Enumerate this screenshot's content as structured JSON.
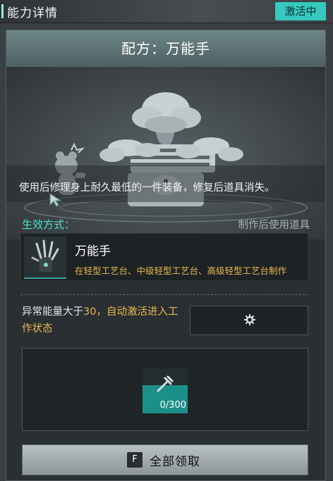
{
  "topbar": {
    "title": "能力详情",
    "status": "激活中"
  },
  "panel": {
    "header_title": "配方：万能手",
    "description": "使用后修理身上耐久最低的一件装备，修复后道具消失。",
    "effect": {
      "label": "生效方式：",
      "value": "制作后使用道具"
    },
    "item": {
      "name": "万能手",
      "source": "在轻型工艺台、中级轻型工艺台、高级轻型工艺台制作"
    },
    "condition": {
      "prefix": "异常能量大于",
      "value": "30",
      "suffix": "，自动激活进入工作状态"
    },
    "slot": {
      "count": "0/300",
      "progress": 0
    },
    "claim": {
      "key": "F",
      "label": "全部领取"
    }
  },
  "colors": {
    "accent": "#37c8be",
    "highlight": "#e5b94f",
    "effect_label": "#4fe0c9"
  },
  "icons": [
    "gear-icon",
    "tool-icon",
    "cursor-icon",
    "bonsai-illustration"
  ]
}
